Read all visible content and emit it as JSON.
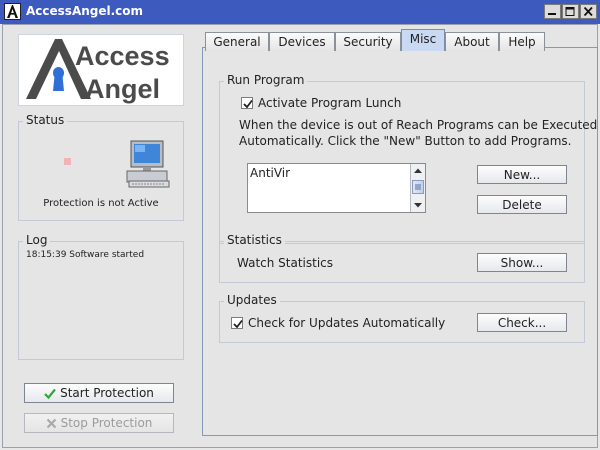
{
  "window": {
    "title": "AccessAngel.com"
  },
  "logo": {
    "line1": "Access",
    "line2": "Angel"
  },
  "status": {
    "title": "Status",
    "text": "Protection is not Active"
  },
  "log": {
    "title": "Log",
    "lines": [
      "18:15:39 Software started"
    ]
  },
  "buttons": {
    "start": "Start Protection",
    "stop": "Stop Protection"
  },
  "tabs": [
    {
      "label": "General"
    },
    {
      "label": "Devices"
    },
    {
      "label": "Security"
    },
    {
      "label": "Misc",
      "active": true
    },
    {
      "label": "About"
    },
    {
      "label": "Help"
    }
  ],
  "run_program": {
    "title": "Run Program",
    "checkbox_label": "Activate Program Lunch",
    "checked": true,
    "description_line1": "When the device is out of Reach Programs can be Executed",
    "description_line2": "Automatically. Click the \"New\" Button to add Programs.",
    "programs": [
      "AntiVir"
    ],
    "new_button": "New...",
    "delete_button": "Delete"
  },
  "statistics": {
    "title": "Statistics",
    "label": "Watch Statistics",
    "show_button": "Show..."
  },
  "updates": {
    "title": "Updates",
    "checkbox_label": "Check for Updates Automatically",
    "checked": true,
    "check_button": "Check..."
  },
  "colors": {
    "titlebar": "#3d5abf",
    "active_tab": "#c9d9f2",
    "logo_gray": "#4b4b4b",
    "logo_blue": "#2f6fd6",
    "status_inactive": "#f1b3b8"
  }
}
